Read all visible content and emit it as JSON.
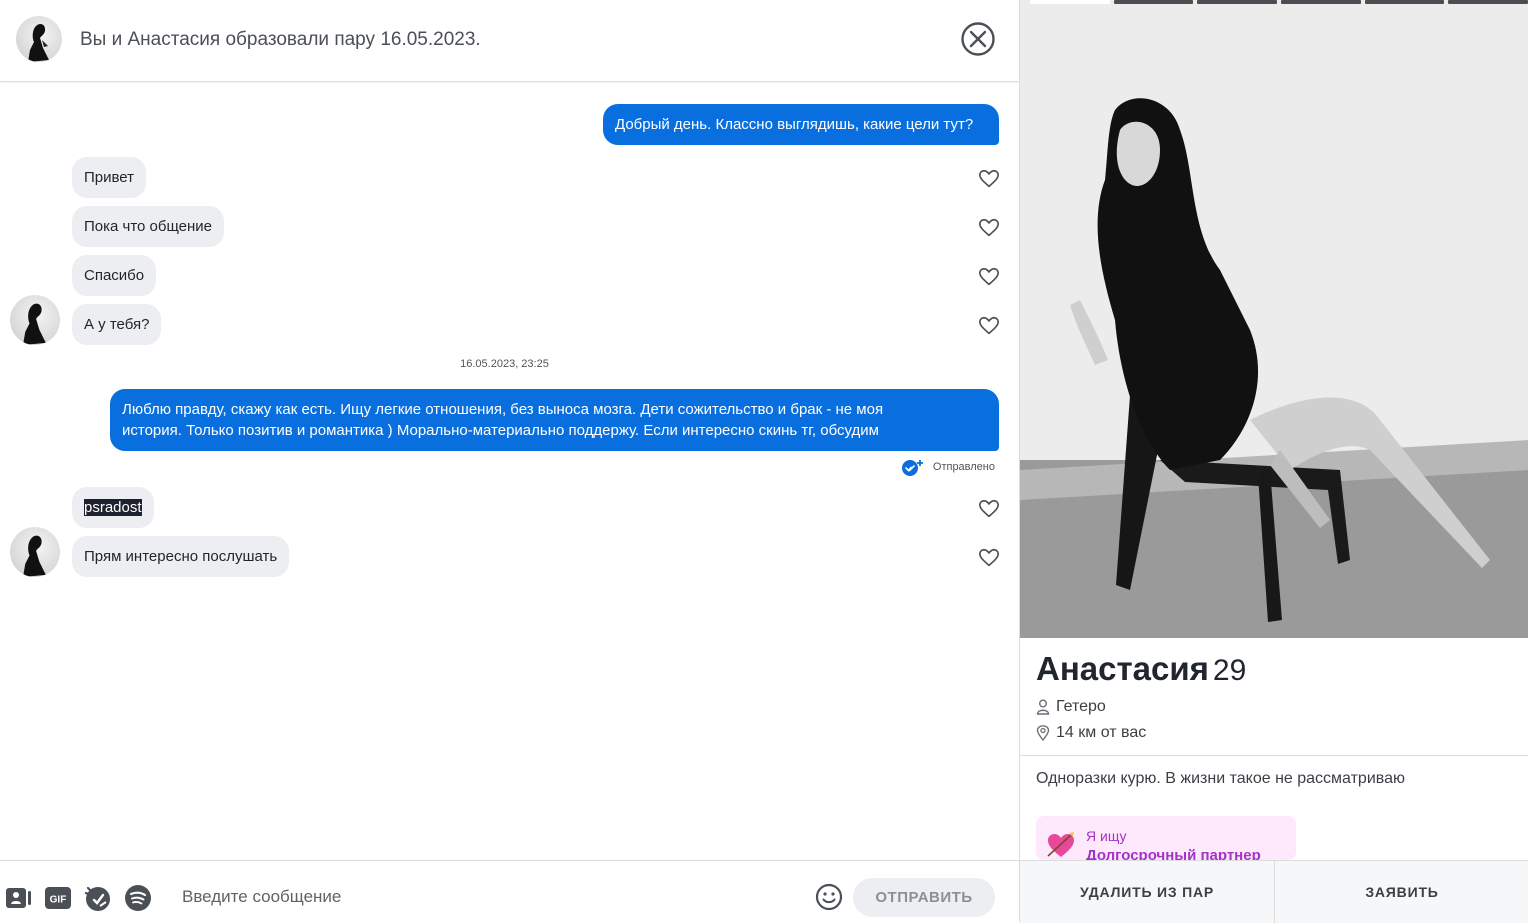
{
  "header": {
    "title": "Вы и Анастасия образовали пару 16.05.2023."
  },
  "messages": {
    "m1": "Добрый день. Классно выглядишь, какие цели тут?",
    "m2": "Привет",
    "m3": "Пока что общение",
    "m4": "Спасибо",
    "m5": "А у тебя?",
    "timestamp": "16.05.2023, 23:25",
    "m6_line1": "Люблю правду, скажу как есть. Ищу легкие отношения, без выноса мозга. Дети сожительство и брак - не моя",
    "m6_line2": "история. Только позитив и романтика ) Морально-материально поддержу. Если интересно скинь тг, обсудим",
    "sent_status": "Отправлено",
    "m7": "psradost",
    "m8": "Прям интересно послушать"
  },
  "input": {
    "placeholder": "Введите сообщение",
    "send_label": "ОТПРАВИТЬ",
    "gif_label": "GIF"
  },
  "profile": {
    "name": "Анастасия",
    "age": "29",
    "orientation": "Гетеро",
    "distance": "14 км от вас",
    "bio": "Одноразки курю. В жизни такое не рассматриваю",
    "looking_label": "Я ищу",
    "looking_value": "Долгосрочный партнер",
    "photo_count": 6,
    "active_photo": 1,
    "remove_label": "УДАЛИТЬ ИЗ ПАР",
    "report_label": "ЗАЯВИТЬ"
  },
  "colors": {
    "outgoing_bubble": "#0a6fde",
    "incoming_bubble": "#eceef1",
    "accent_purple": "#a333c8"
  }
}
